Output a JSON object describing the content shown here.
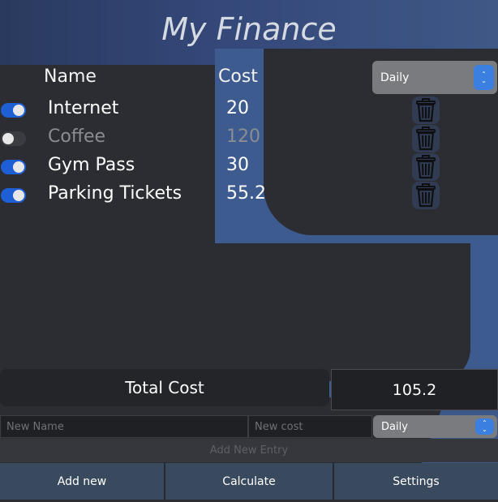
{
  "app": {
    "title": "My Finance"
  },
  "columns": {
    "name": "Name",
    "cost": "Cost"
  },
  "period": {
    "selected": "Daily"
  },
  "entries": [
    {
      "name": "Internet",
      "cost": "20",
      "enabled": true
    },
    {
      "name": "Coffee",
      "cost": "120",
      "enabled": false
    },
    {
      "name": "Gym Pass",
      "cost": "30",
      "enabled": true
    },
    {
      "name": "Parking Tickets",
      "cost": "55.2",
      "enabled": true
    }
  ],
  "total": {
    "label": "Total Cost",
    "value": "105.2"
  },
  "new_entry": {
    "name_placeholder": "New Name",
    "cost_placeholder": "New cost",
    "period_selected": "Daily",
    "add_label": "Add New Entry"
  },
  "footer": {
    "add_new": "Add new",
    "calculate": "Calculate",
    "settings": "Settings"
  },
  "colors": {
    "accent": "#3b7fe0",
    "toggle_on": "#1f5fd6",
    "background": "#2b2d33",
    "band": "#3d5b8f"
  },
  "icons": {
    "delete": "trash-icon",
    "spinner": "up-down-chevron-icon"
  }
}
